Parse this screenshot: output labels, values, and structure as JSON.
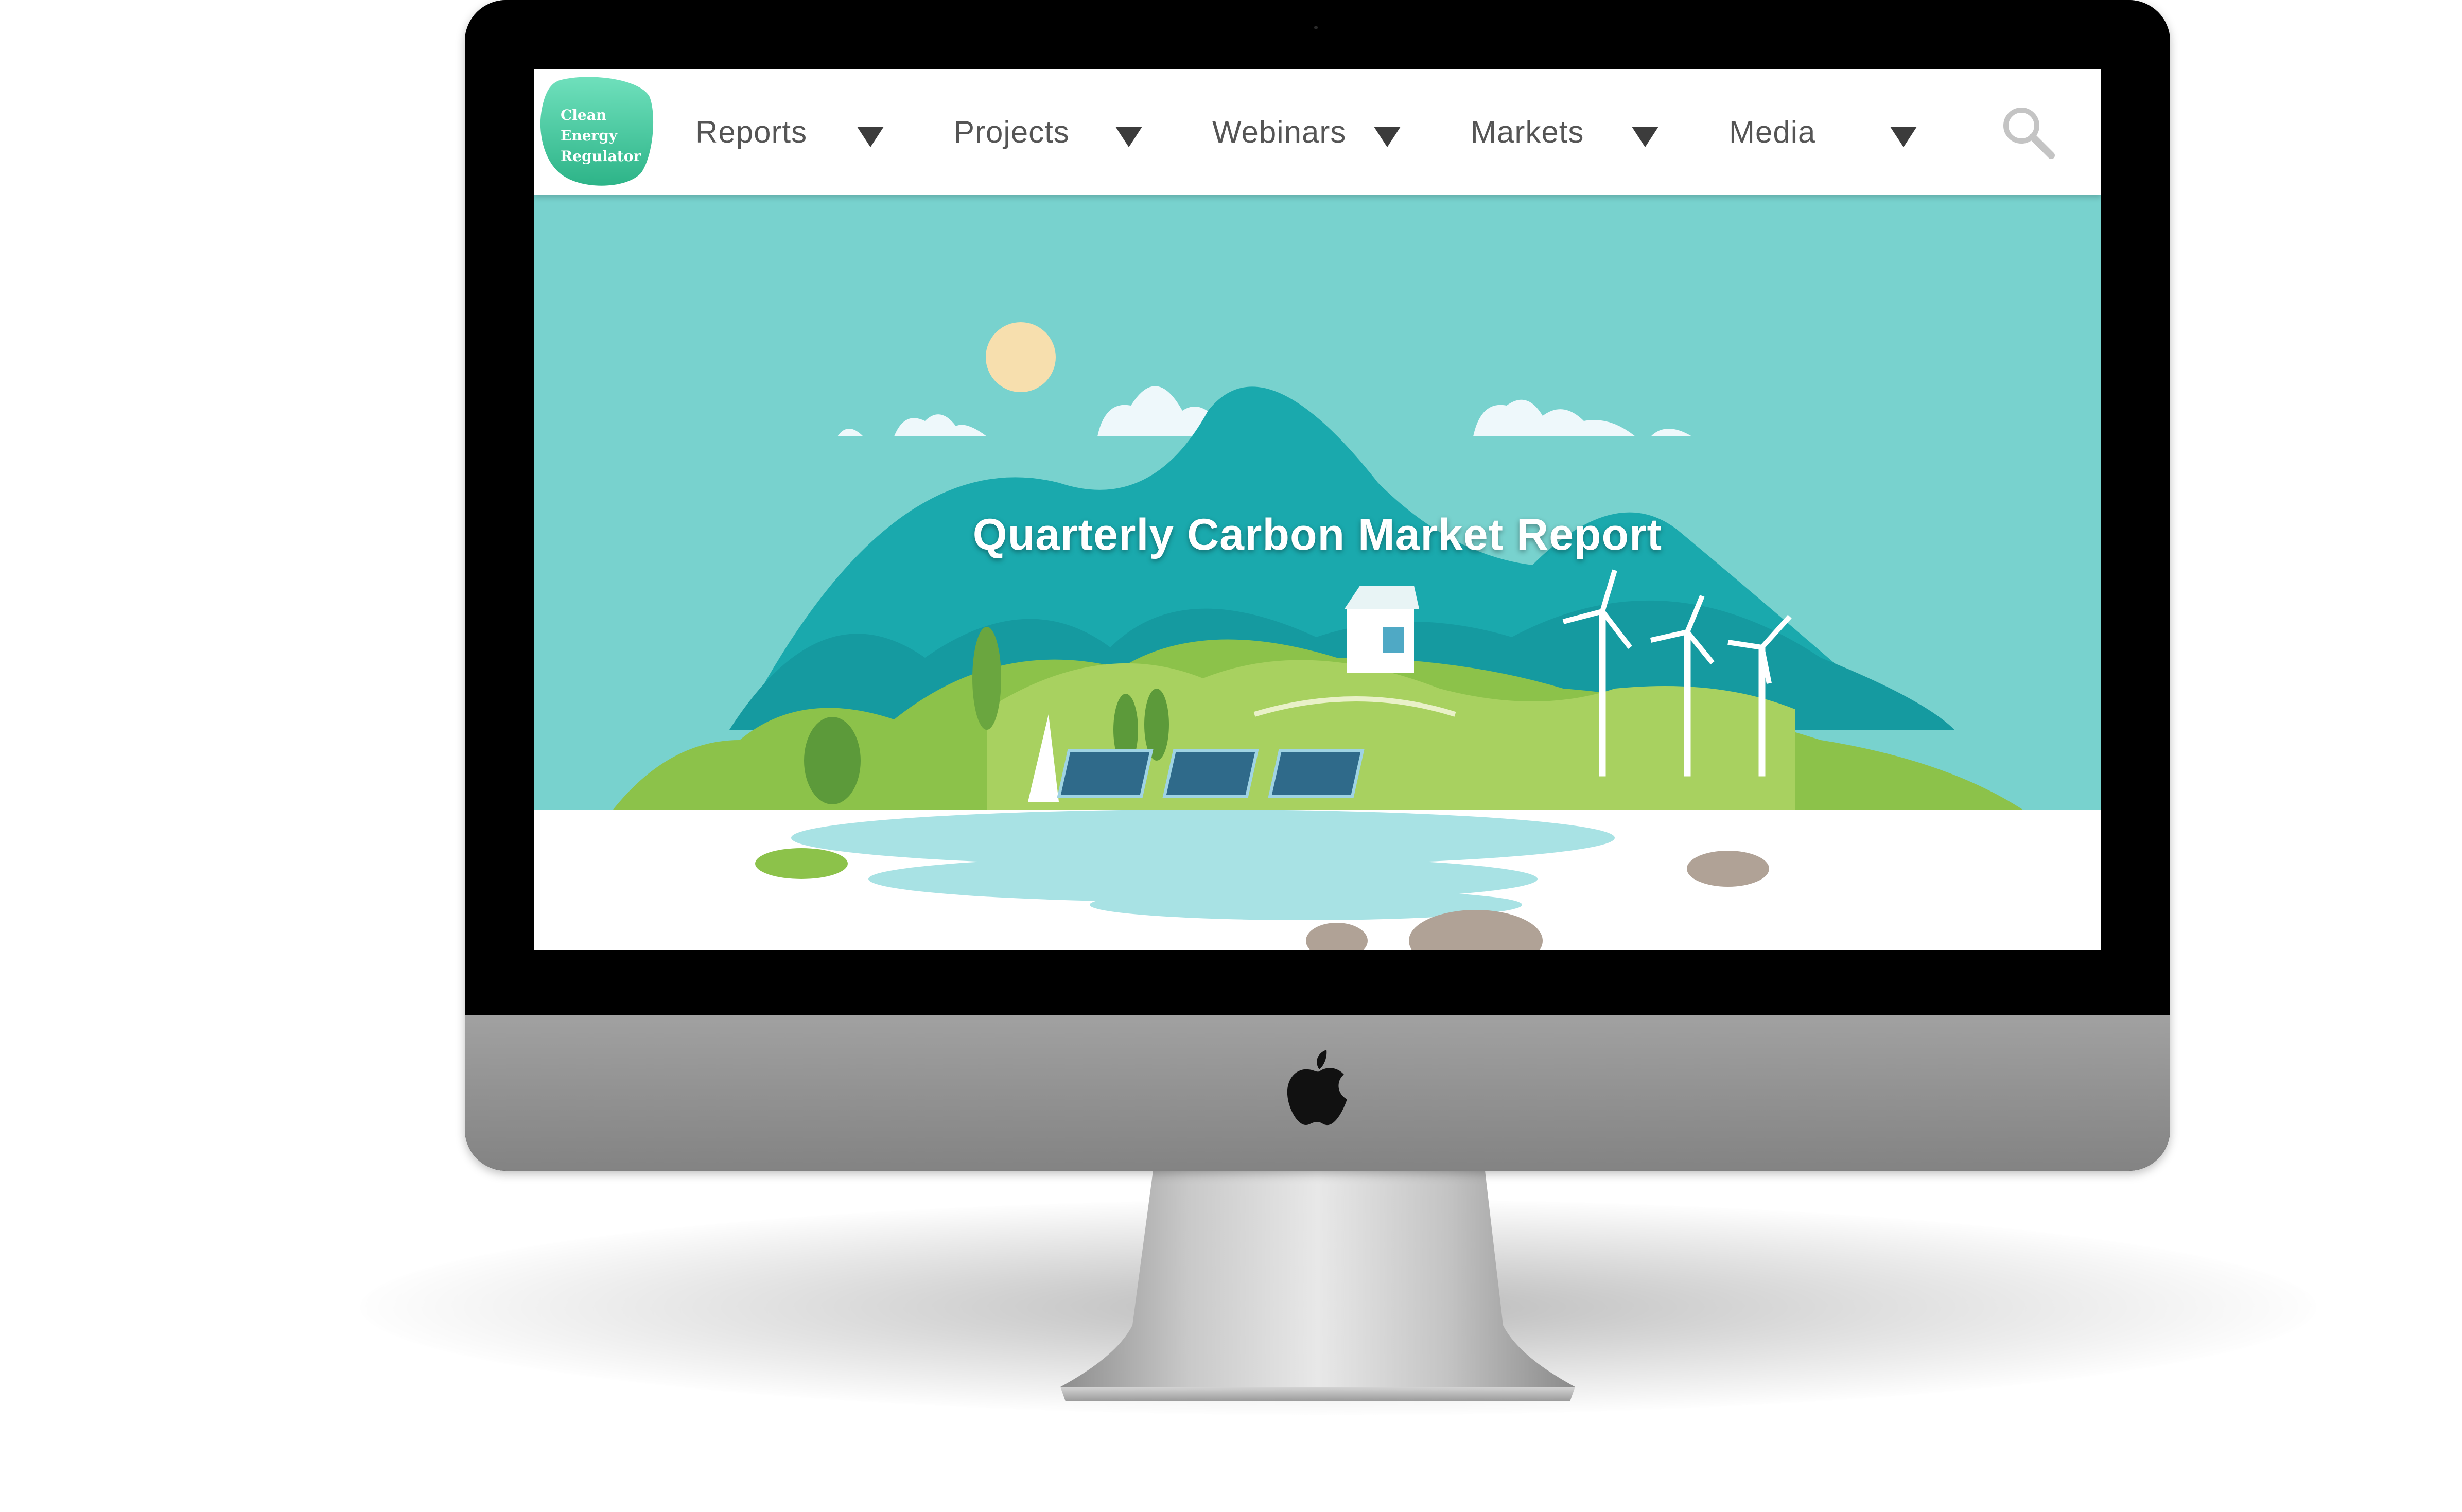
{
  "brand": {
    "logo_lines": [
      "Clean",
      "Energy",
      "Regulator"
    ],
    "color": "#3dbf96"
  },
  "nav": {
    "items": [
      {
        "label": "Reports",
        "icon": "chevron-down-icon"
      },
      {
        "label": "Projects",
        "icon": "chevron-down-icon"
      },
      {
        "label": "Webinars",
        "icon": "chevron-down-icon"
      },
      {
        "label": "Markets",
        "icon": "chevron-down-icon"
      },
      {
        "label": "Media",
        "icon": "chevron-down-icon"
      }
    ],
    "search_icon": "search-icon"
  },
  "hero": {
    "title": "Quarterly Carbon Market Report",
    "background_color": "#78d2ce"
  },
  "device": {
    "type": "iMac",
    "logo_icon": "apple-logo-icon"
  }
}
